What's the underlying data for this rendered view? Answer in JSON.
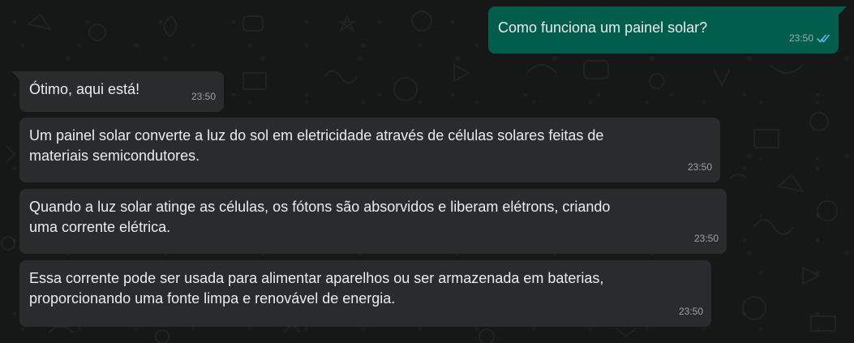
{
  "chat": {
    "outgoing": {
      "text": "Como funciona um painel solar?",
      "time": "23:50",
      "status_icon": "double-check-read-icon",
      "status_color": "#53bdeb"
    },
    "incoming": [
      {
        "text": "Ótimo, aqui está!",
        "time": "23:50"
      },
      {
        "text": "Um painel solar converte a luz do sol em eletricidade através de células solares feitas de\nmateriais semicondutores.",
        "time": "23:50"
      },
      {
        "text": "Quando a luz solar atinge as células, os fótons são absorvidos e liberam elétrons, criando\numa corrente elétrica.",
        "time": "23:50"
      },
      {
        "text": "Essa corrente pode ser usada para alimentar aparelhos ou ser armazenada em baterias,\nproporcionando uma fonte limpa e renovável de energia.",
        "time": "23:50"
      }
    ]
  },
  "colors": {
    "background": "#161717",
    "outgoing_bubble": "#005c4b",
    "incoming_bubble": "#2a2b2c",
    "text": "#e9edef"
  }
}
